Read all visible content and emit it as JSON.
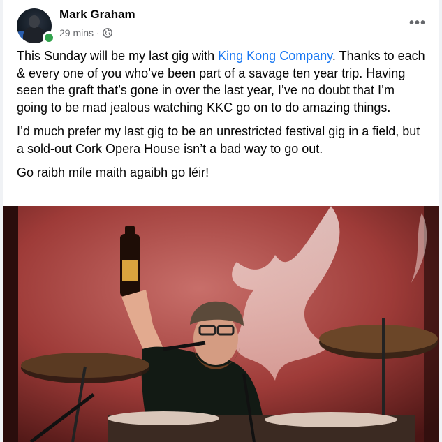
{
  "post": {
    "author": "Mark Graham",
    "time": "29 mins",
    "separator": "·",
    "privacy_icon": "globe-icon",
    "more_icon": "more-options-icon",
    "paragraphs": [
      {
        "before": "This Sunday will be my last gig with ",
        "link": "King Kong Company",
        "after": ". Thanks to each & every one of you who’ve been part of a savage ten year trip. Having seen the graft that’s gone in over the last year, I’ve no doubt that I’m going to be mad jealous watching KKC go on to do amazing things."
      },
      {
        "text": "I’d much prefer my last gig to be an unrestricted festival gig in a field, but a sold-out Cork Opera House isn’t a bad way to go out."
      },
      {
        "text": "Go raibh míle maith agaibh go léir!"
      }
    ]
  },
  "colors": {
    "link": "#1877f2",
    "online": "#31a24c",
    "secondary_text": "#65676b"
  }
}
